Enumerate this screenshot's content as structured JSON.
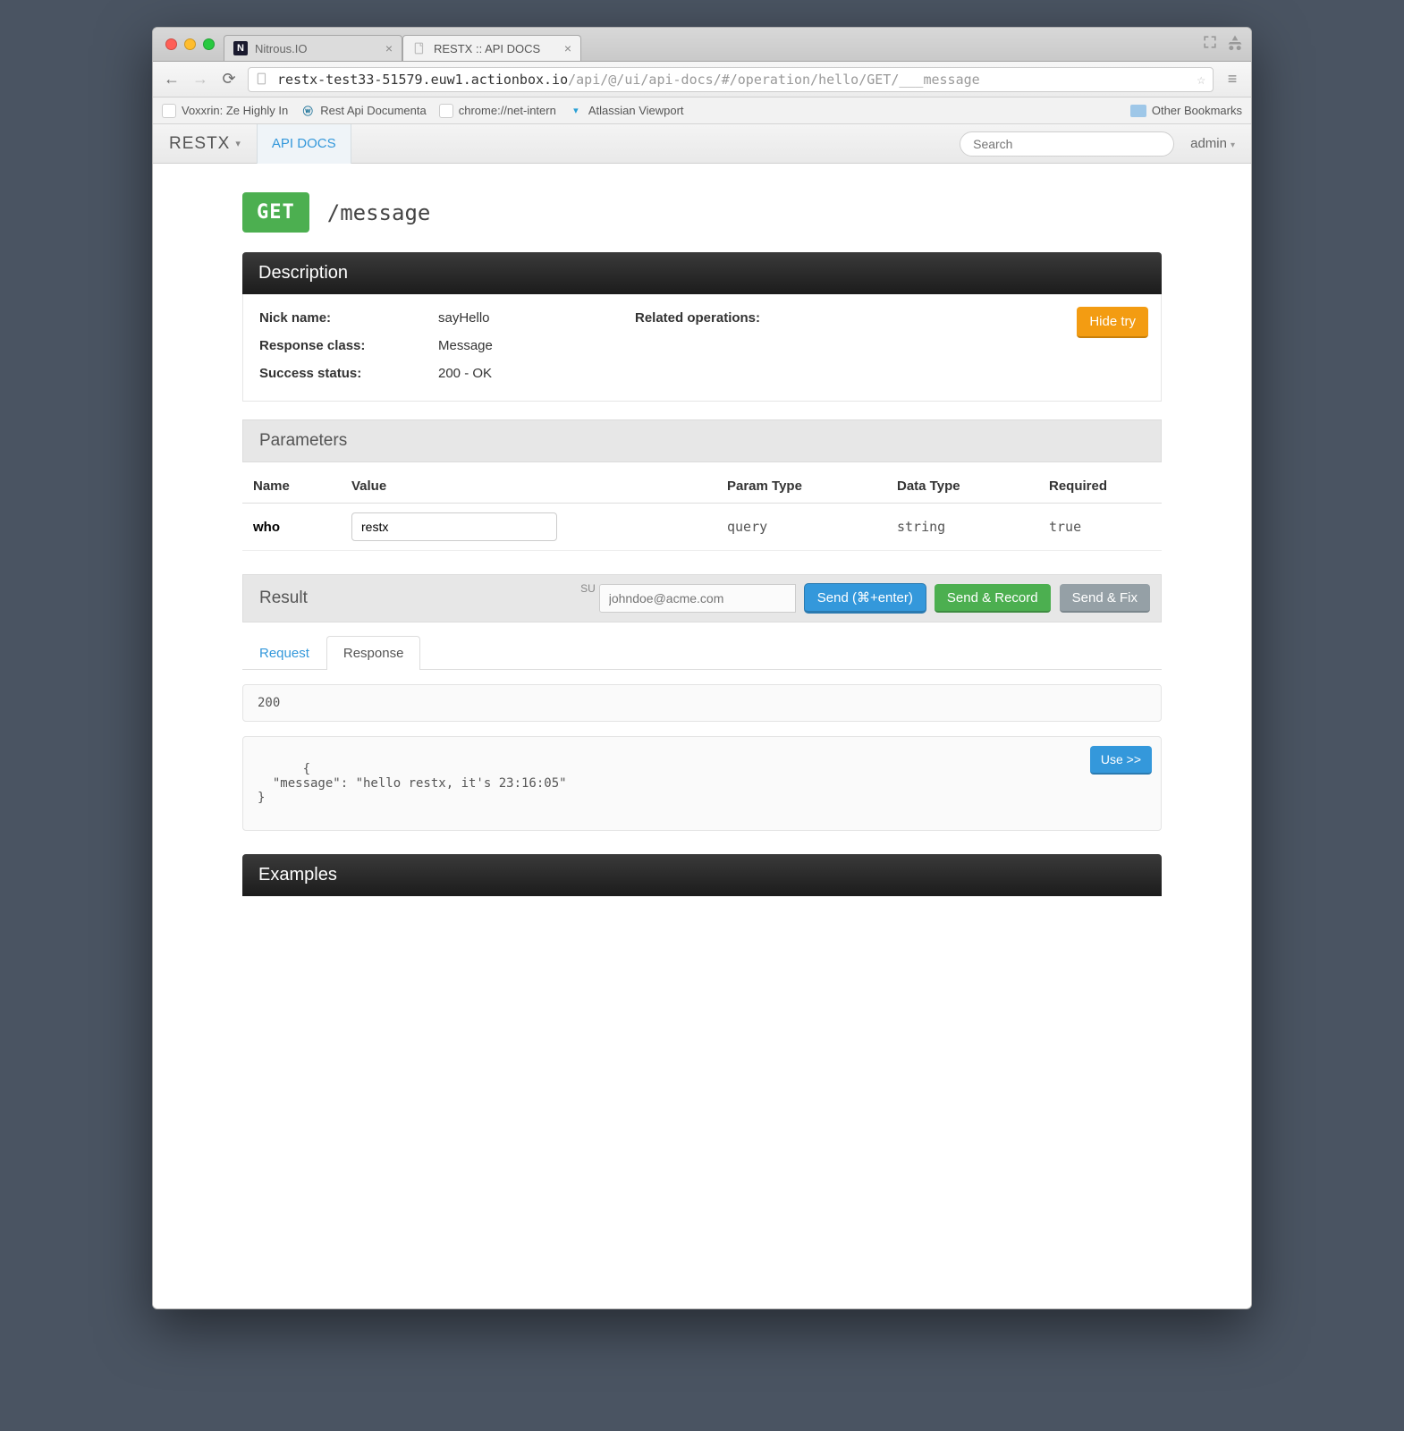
{
  "browser": {
    "tabs": [
      {
        "title": "Nitrous.IO",
        "active": false
      },
      {
        "title": "RESTX :: API DOCS",
        "active": true
      }
    ],
    "url_host": "restx-test33-51579.euw1.actionbox.io",
    "url_path": "/api/@/ui/api-docs/#/operation/hello/GET/___message",
    "bookmarks": [
      "Voxxrin: Ze Highly In",
      "Rest Api Documenta",
      "chrome://net-intern",
      "Atlassian Viewport"
    ],
    "other_bookmarks": "Other Bookmarks"
  },
  "nav": {
    "brand": "RESTX",
    "tab": "API DOCS",
    "search_placeholder": "Search",
    "user": "admin"
  },
  "operation": {
    "method": "GET",
    "path": "/message"
  },
  "sections": {
    "description": "Description",
    "parameters": "Parameters",
    "result": "Result",
    "examples": "Examples"
  },
  "description": {
    "nick_label": "Nick name:",
    "nick_value": "sayHello",
    "response_class_label": "Response class:",
    "response_class_value": "Message",
    "success_status_label": "Success status:",
    "success_status_value": "200 - OK",
    "related_label": "Related operations:",
    "hide_try": "Hide try"
  },
  "param_headers": {
    "name": "Name",
    "value": "Value",
    "param_type": "Param Type",
    "data_type": "Data Type",
    "required": "Required"
  },
  "parameters": [
    {
      "name": "who",
      "value": "restx",
      "param_type": "query",
      "data_type": "string",
      "required": "true"
    }
  ],
  "result": {
    "su_label": "SU",
    "su_placeholder": "johndoe@acme.com",
    "send": "Send (⌘+enter)",
    "send_record": "Send & Record",
    "send_fix": "Send & Fix",
    "tab_request": "Request",
    "tab_response": "Response",
    "status_code": "200",
    "body": "{\n  \"message\": \"hello restx, it's 23:16:05\"\n}",
    "use": "Use >>"
  }
}
